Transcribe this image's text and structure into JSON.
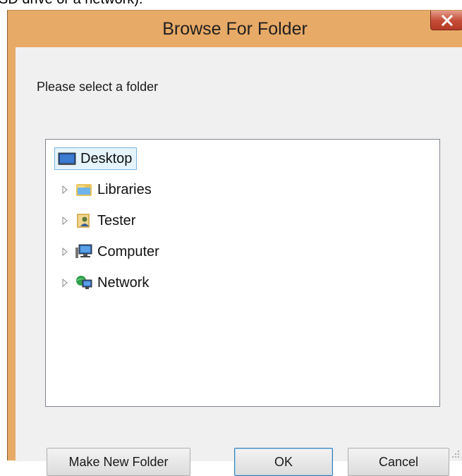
{
  "background_text": "SD drive or a network).",
  "dialog": {
    "title": "Browse For Folder",
    "prompt": "Please select a folder"
  },
  "tree": {
    "items": [
      {
        "label": "Desktop",
        "icon": "desktop-icon",
        "expandable": false,
        "selected": true
      },
      {
        "label": "Libraries",
        "icon": "libraries-icon",
        "expandable": true,
        "selected": false
      },
      {
        "label": "Tester",
        "icon": "user-folder-icon",
        "expandable": true,
        "selected": false
      },
      {
        "label": "Computer",
        "icon": "computer-icon",
        "expandable": true,
        "selected": false
      },
      {
        "label": "Network",
        "icon": "network-icon",
        "expandable": true,
        "selected": false
      }
    ]
  },
  "buttons": {
    "make_new_folder": "Make New Folder",
    "ok": "OK",
    "cancel": "Cancel"
  },
  "colors": {
    "frame": "#e8aa67",
    "close_button": "#c44b36",
    "selection": "#e5f3fb"
  }
}
